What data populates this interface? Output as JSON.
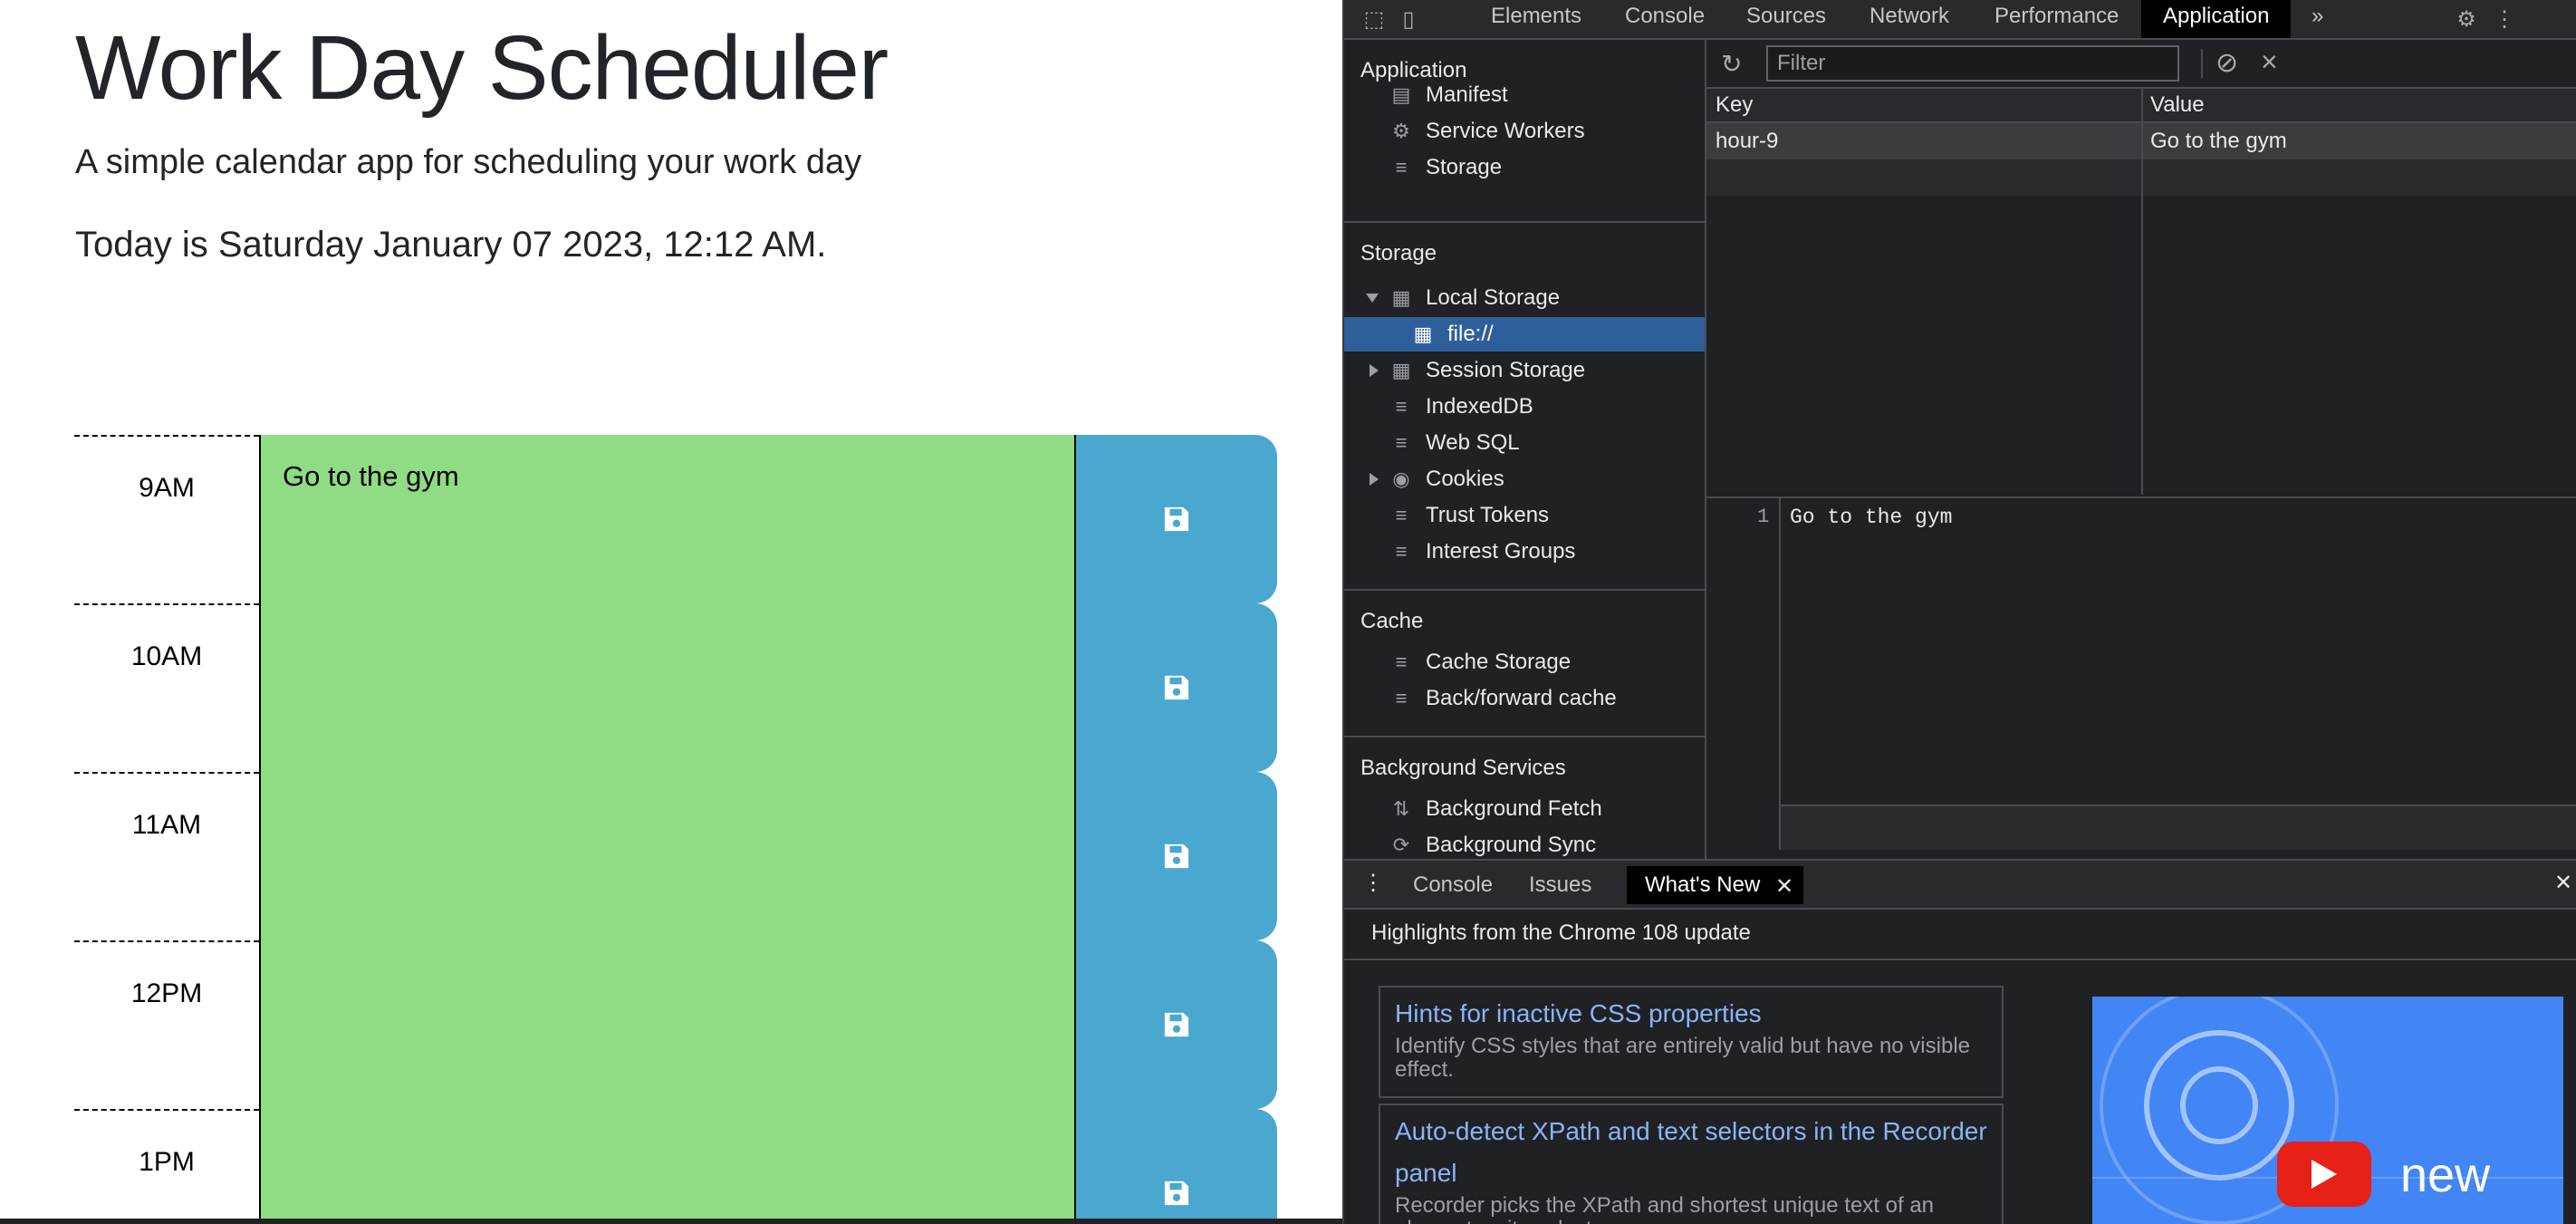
{
  "app": {
    "title": "Work Day Scheduler",
    "subtitle": "A simple calendar app for scheduling your work day",
    "today": "Today is Saturday January 07 2023, 12:12 AM.",
    "rows": [
      {
        "hour": "9AM",
        "text": "Go to the gym",
        "status": "future"
      },
      {
        "hour": "10AM",
        "text": "",
        "status": "future"
      },
      {
        "hour": "11AM",
        "text": "",
        "status": "future"
      },
      {
        "hour": "12PM",
        "text": "",
        "status": "future"
      },
      {
        "hour": "1PM",
        "text": "",
        "status": "future"
      }
    ],
    "colors": {
      "future": "#90dc84",
      "save": "#4aa8d0"
    }
  },
  "devtools": {
    "tabs": [
      "Elements",
      "Console",
      "Sources",
      "Network",
      "Performance",
      "Application"
    ],
    "active_tab": "Application",
    "more": "»",
    "sidebar": {
      "application": {
        "title": "Application",
        "items": [
          "Manifest",
          "Service Workers",
          "Storage"
        ]
      },
      "storage": {
        "title": "Storage",
        "items": [
          "Local Storage",
          "file://",
          "Session Storage",
          "IndexedDB",
          "Web SQL",
          "Cookies",
          "Trust Tokens",
          "Interest Groups"
        ]
      },
      "cache": {
        "title": "Cache",
        "items": [
          "Cache Storage",
          "Back/forward cache"
        ]
      },
      "background": {
        "title": "Background Services",
        "items": [
          "Background Fetch",
          "Background Sync"
        ]
      }
    },
    "filter_placeholder": "Filter",
    "table": {
      "columns": [
        "Key",
        "Value"
      ],
      "rows": [
        {
          "key": "hour-9",
          "value": "Go to the gym"
        }
      ]
    },
    "editor": {
      "line": "1",
      "content": "Go to the gym"
    },
    "drawer": {
      "tabs": [
        "Console",
        "Issues",
        "What's New"
      ],
      "active_tab": "What's New",
      "highlights": "Highlights from the Chrome 108 update",
      "cards": [
        {
          "title": "Hints for inactive CSS properties",
          "desc": "Identify CSS styles that are entirely valid but have no visible effect."
        },
        {
          "title": "Auto-detect XPath and text selectors in the Recorder panel",
          "desc": "Recorder picks the XPath and shortest unique text of an element as its selector."
        }
      ],
      "promo_text": "new"
    }
  }
}
